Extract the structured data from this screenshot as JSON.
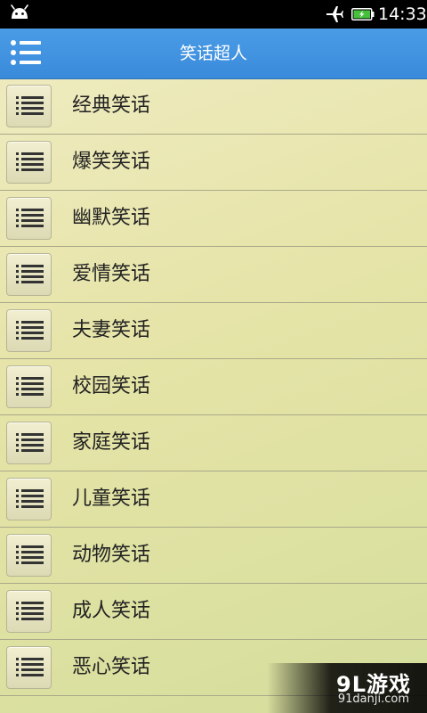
{
  "status_bar": {
    "time": "14:33",
    "icons": [
      "android-icon",
      "airplane-mode-icon",
      "battery-charging-icon"
    ],
    "battery_color": "#45c03a"
  },
  "title_bar": {
    "title": "笑话超人",
    "menu_icon": "menu-list-icon",
    "color": "#3f93e1"
  },
  "categories": [
    {
      "label": "经典笑话",
      "icon": "list-icon"
    },
    {
      "label": "爆笑笑话",
      "icon": "list-icon"
    },
    {
      "label": "幽默笑话",
      "icon": "list-icon"
    },
    {
      "label": "爱情笑话",
      "icon": "list-icon"
    },
    {
      "label": "夫妻笑话",
      "icon": "list-icon"
    },
    {
      "label": "校园笑话",
      "icon": "list-icon"
    },
    {
      "label": "家庭笑话",
      "icon": "list-icon"
    },
    {
      "label": "儿童笑话",
      "icon": "list-icon"
    },
    {
      "label": "动物笑话",
      "icon": "list-icon"
    },
    {
      "label": "成人笑话",
      "icon": "list-icon"
    },
    {
      "label": "恶心笑话",
      "icon": "list-icon"
    }
  ],
  "watermark": {
    "brand": "9L游戏",
    "site": "91danji.com"
  }
}
